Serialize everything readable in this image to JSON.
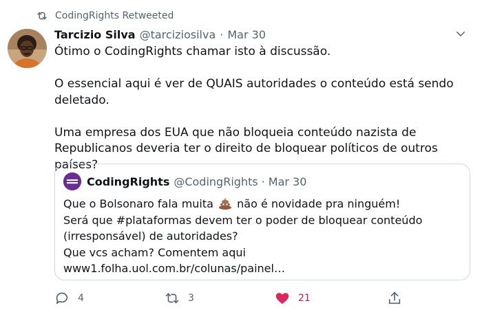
{
  "retweet": {
    "text": "CodingRights Retweeted",
    "icon": "retweet-icon"
  },
  "tweet": {
    "author_name": "Tarcizio Silva",
    "author_handle": "@tarciziosilva",
    "separator": "·",
    "date": "Mar 30",
    "paragraphs": [
      "Ótimo o CodingRights chamar isto à discussão.",
      "O essencial aqui é ver de QUAIS autoridades o conteúdo está sendo deletado.",
      "Uma empresa dos EUA que não bloqueia conteúdo nazista de Republicanos deveria ter o direito de bloquear políticos de outros países?"
    ]
  },
  "quote": {
    "author_name": "CodingRights",
    "author_handle": "@CodingRights",
    "separator": "·",
    "date": "Mar 30",
    "line1_before": "Que o Bolsonaro fala muita",
    "line1_after": "não é novidade pra ninguém!",
    "line2": "Será que #plataformas devem ter o poder de bloquear conteúdo (irresponsável) de autoridades?",
    "line3": "Que vcs acham? Comentem aqui",
    "line4": "www1.folha.uol.com.br/colunas/painel…"
  },
  "actions": {
    "reply_count": "4",
    "retweet_count": "3",
    "like_count": "21"
  },
  "colors": {
    "muted": "#536471",
    "like": "#f91880",
    "border": "#cfd9de"
  }
}
